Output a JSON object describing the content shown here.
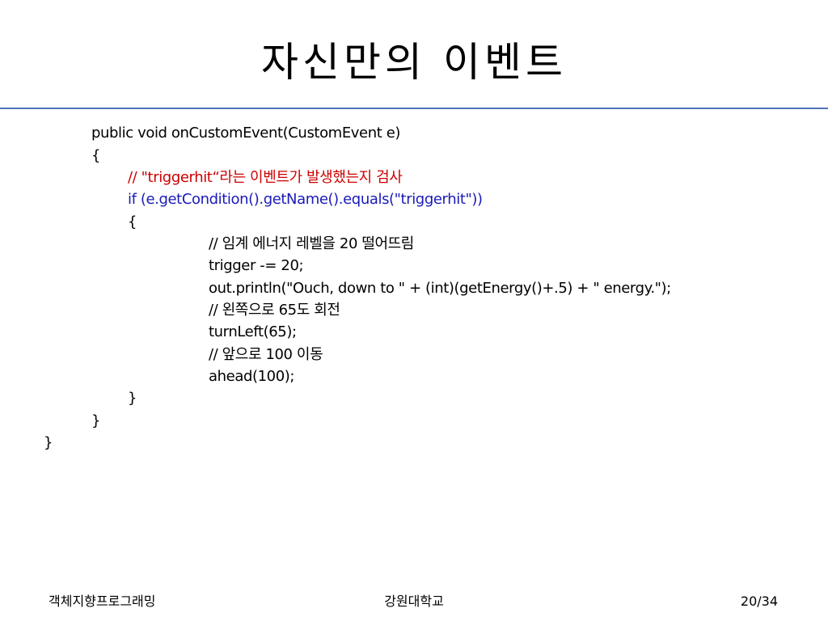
{
  "slide": {
    "title": "자신만의 이벤트"
  },
  "code": {
    "lines": [
      "public void onCustomEvent(CustomEvent e)",
      "{",
      "// \"triggerhit“라는 이벤트가 발생했는지 검사",
      "if (e.getCondition().getName().equals(\"triggerhit\"))",
      "{",
      "// 임계 에너지 레벨을 20 떨어뜨림",
      "trigger -= 20;",
      "out.println(\"Ouch, down to \" + (int)(getEnergy()+.5) + \" energy.\");",
      "// 왼쪽으로 65도 회전",
      "turnLeft(65);",
      "// 앞으로 100 이동",
      "ahead(100);",
      "}",
      "}",
      "}"
    ]
  },
  "footer": {
    "course": "객체지향프로그래밍",
    "school": "강원대학교",
    "page": "20/34"
  },
  "colors": {
    "title_rule": "#4f73b8",
    "comment": "#cc0000",
    "keyword_line": "#1a1ab8"
  }
}
